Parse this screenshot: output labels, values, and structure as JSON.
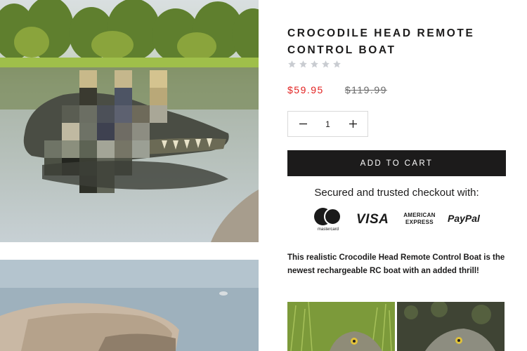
{
  "product": {
    "title": "Crocodile Head Remote Control Boat",
    "rating_stars": 5,
    "rating_value": 0,
    "price_sale": "$59.95",
    "price_compare": "$119.99",
    "quantity": "1",
    "add_to_cart_label": "ADD TO CART",
    "secure_checkout_text": "Secured and trusted checkout with:",
    "payments": {
      "mastercard_label": "mastercard",
      "visa_label": "VISA",
      "amex_line1": "AMERICAN",
      "amex_line2": "EXPRESS",
      "paypal_label": "PayPal"
    },
    "description": "This realistic Crocodile Head Remote Control  Boat is the newest rechargeable RC boat with an added thrill!"
  },
  "colors": {
    "sale_price": "#e22120",
    "button_bg": "#1c1b1b",
    "star": "#c9ccd1"
  },
  "icons": [
    "star-icon",
    "minus-icon",
    "plus-icon"
  ]
}
